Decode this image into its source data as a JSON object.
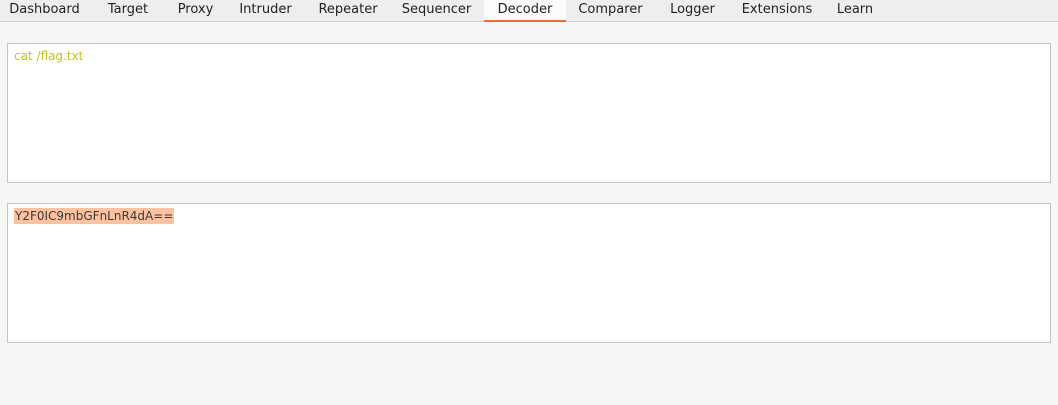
{
  "tabs": [
    {
      "label": "Dashboard"
    },
    {
      "label": "Target"
    },
    {
      "label": "Proxy"
    },
    {
      "label": "Intruder"
    },
    {
      "label": "Repeater"
    },
    {
      "label": "Sequencer"
    },
    {
      "label": "Decoder",
      "active": true
    },
    {
      "label": "Comparer"
    },
    {
      "label": "Logger"
    },
    {
      "label": "Extensions"
    },
    {
      "label": "Learn"
    }
  ],
  "decoder": {
    "input_text": "cat /flag.txt",
    "output_text": "Y2F0IC9mbGFnLnR4dA=="
  },
  "colors": {
    "accent": "#ee6b3b",
    "input_text": "#c3c322",
    "selection_highlight": "#ffc2a0"
  }
}
